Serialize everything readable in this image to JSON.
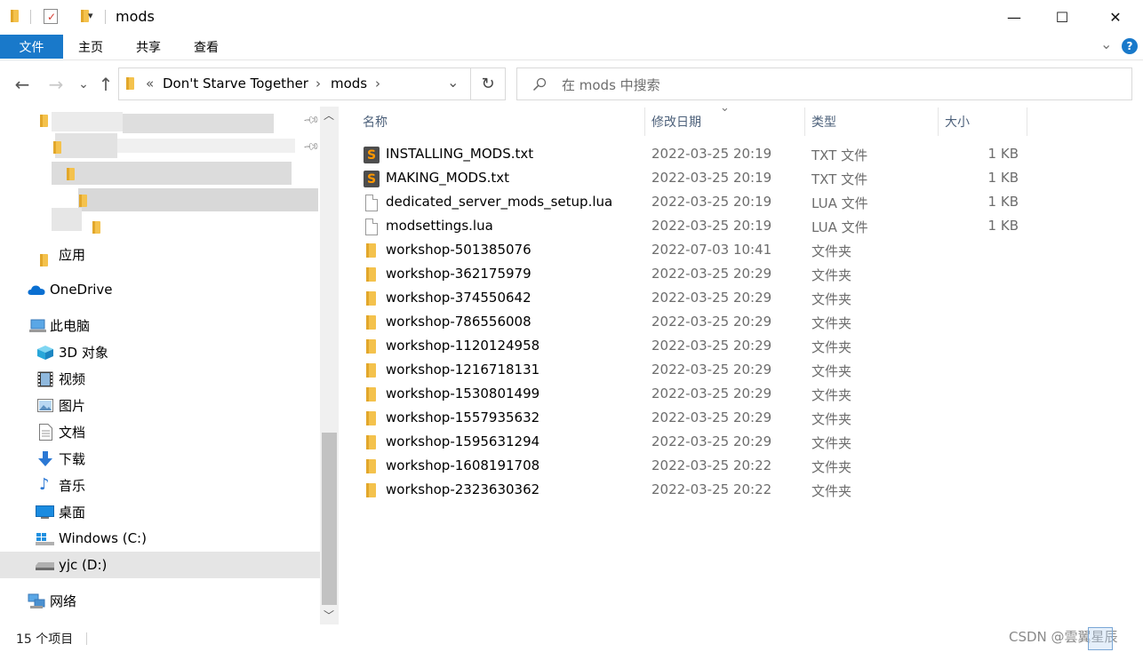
{
  "window": {
    "title": "mods",
    "minimize_glyph": "—",
    "maximize_glyph": "☐",
    "close_glyph": "✕"
  },
  "ribbon": {
    "tabs": [
      "文件",
      "主页",
      "共享",
      "查看"
    ],
    "active_tab": "文件",
    "collapse_glyph": "⌄",
    "help_glyph": "?"
  },
  "address": {
    "back_glyph": "←",
    "forward_glyph": "→",
    "recent_glyph": "⌄",
    "up_glyph": "↑",
    "overflow": "«",
    "crumbs": [
      "Don't Starve Together",
      "mods"
    ],
    "sep": "›",
    "dropdown_glyph": "⌄",
    "refresh_glyph": "↻",
    "search_placeholder": "在 mods 中搜索"
  },
  "nav_pane": {
    "quick_access_last": "应用",
    "onedrive": "OneDrive",
    "this_pc": "此电脑",
    "pc_items": [
      "3D 对象",
      "视频",
      "图片",
      "文档",
      "下载",
      "音乐",
      "桌面",
      "Windows (C:)",
      "yjc (D:)"
    ],
    "network": "网络",
    "selected": "yjc (D:)",
    "scroll_up_glyph": "︿",
    "scroll_down_glyph": "﹀"
  },
  "columns": {
    "name": "名称",
    "date": "修改日期",
    "type": "类型",
    "size": "大小",
    "sort_glyph": "⌄"
  },
  "files": [
    {
      "name": "INSTALLING_MODS.txt",
      "date": "2022-03-25 20:19",
      "type": "TXT 文件",
      "size": "1 KB",
      "icon": "sublime-text-icon"
    },
    {
      "name": "MAKING_MODS.txt",
      "date": "2022-03-25 20:19",
      "type": "TXT 文件",
      "size": "1 KB",
      "icon": "sublime-text-icon"
    },
    {
      "name": "dedicated_server_mods_setup.lua",
      "date": "2022-03-25 20:19",
      "type": "LUA 文件",
      "size": "1 KB",
      "icon": "document-icon"
    },
    {
      "name": "modsettings.lua",
      "date": "2022-03-25 20:19",
      "type": "LUA 文件",
      "size": "1 KB",
      "icon": "document-icon"
    },
    {
      "name": "workshop-501385076",
      "date": "2022-07-03 10:41",
      "type": "文件夹",
      "size": "",
      "icon": "folder-icon"
    },
    {
      "name": "workshop-362175979",
      "date": "2022-03-25 20:29",
      "type": "文件夹",
      "size": "",
      "icon": "folder-icon"
    },
    {
      "name": "workshop-374550642",
      "date": "2022-03-25 20:29",
      "type": "文件夹",
      "size": "",
      "icon": "folder-icon"
    },
    {
      "name": "workshop-786556008",
      "date": "2022-03-25 20:29",
      "type": "文件夹",
      "size": "",
      "icon": "folder-icon"
    },
    {
      "name": "workshop-1120124958",
      "date": "2022-03-25 20:29",
      "type": "文件夹",
      "size": "",
      "icon": "folder-icon"
    },
    {
      "name": "workshop-1216718131",
      "date": "2022-03-25 20:29",
      "type": "文件夹",
      "size": "",
      "icon": "folder-icon"
    },
    {
      "name": "workshop-1530801499",
      "date": "2022-03-25 20:29",
      "type": "文件夹",
      "size": "",
      "icon": "folder-icon"
    },
    {
      "name": "workshop-1557935632",
      "date": "2022-03-25 20:29",
      "type": "文件夹",
      "size": "",
      "icon": "folder-icon"
    },
    {
      "name": "workshop-1595631294",
      "date": "2022-03-25 20:29",
      "type": "文件夹",
      "size": "",
      "icon": "folder-icon"
    },
    {
      "name": "workshop-1608191708",
      "date": "2022-03-25 20:22",
      "type": "文件夹",
      "size": "",
      "icon": "folder-icon"
    },
    {
      "name": "workshop-2323630362",
      "date": "2022-03-25 20:22",
      "type": "文件夹",
      "size": "",
      "icon": "folder-icon"
    }
  ],
  "status": {
    "item_count": "15 个项目"
  },
  "watermark": "CSDN @雲翼星辰",
  "colors": {
    "accent": "#1979ca",
    "selection": "#e5e5e5",
    "folder": "#f4c24d",
    "header_text": "#4c607a",
    "meta_text": "#6d6d6d"
  }
}
